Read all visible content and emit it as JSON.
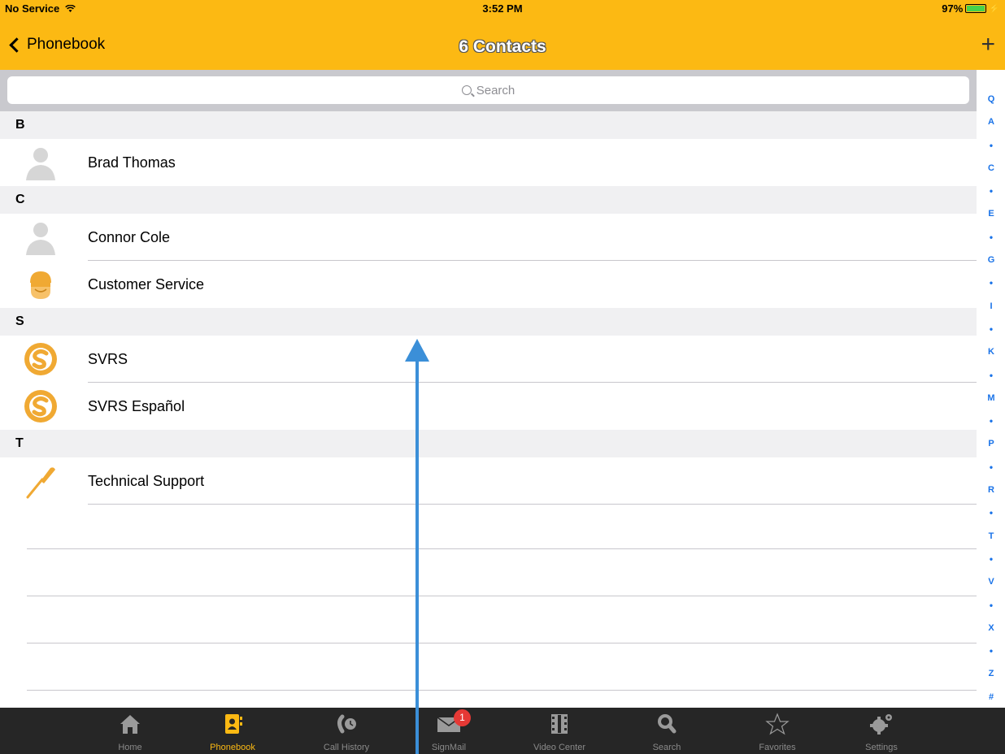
{
  "status_bar": {
    "carrier": "No Service",
    "time": "3:52 PM",
    "battery": "97%"
  },
  "nav": {
    "back_label": "Phonebook",
    "title": "6 Contacts",
    "add_label": "+"
  },
  "search": {
    "placeholder": "Search"
  },
  "sections": [
    {
      "letter": "B",
      "contacts": [
        {
          "name": "Brad Thomas",
          "icon": "person-placeholder-icon"
        }
      ]
    },
    {
      "letter": "C",
      "contacts": [
        {
          "name": "Connor Cole",
          "icon": "person-placeholder-icon"
        },
        {
          "name": "Customer Service",
          "icon": "headset-agent-icon"
        }
      ]
    },
    {
      "letter": "S",
      "contacts": [
        {
          "name": "SVRS",
          "icon": "svrs-logo-icon"
        },
        {
          "name": "SVRS Español",
          "icon": "svrs-logo-icon"
        }
      ]
    },
    {
      "letter": "T",
      "contacts": [
        {
          "name": "Technical Support",
          "icon": "screwdriver-icon"
        }
      ]
    }
  ],
  "index": [
    "Q",
    "A",
    "•",
    "C",
    "•",
    "E",
    "•",
    "G",
    "•",
    "I",
    "•",
    "K",
    "•",
    "M",
    "•",
    "P",
    "•",
    "R",
    "•",
    "T",
    "•",
    "V",
    "•",
    "X",
    "•",
    "Z",
    "#"
  ],
  "tabs": [
    {
      "label": "Home",
      "icon": "home-icon"
    },
    {
      "label": "Phonebook",
      "icon": "phonebook-icon",
      "active": true
    },
    {
      "label": "Call History",
      "icon": "call-history-icon"
    },
    {
      "label": "SignMail",
      "icon": "envelope-icon",
      "badge": "1"
    },
    {
      "label": "Video Center",
      "icon": "film-icon"
    },
    {
      "label": "Search",
      "icon": "search-icon"
    },
    {
      "label": "Favorites",
      "icon": "star-icon"
    },
    {
      "label": "Settings",
      "icon": "gear-icon"
    }
  ],
  "colors": {
    "accent": "#fcb913",
    "index": "#1a73e8",
    "tabbar": "#262626",
    "annotation": "#3b8fd8"
  }
}
